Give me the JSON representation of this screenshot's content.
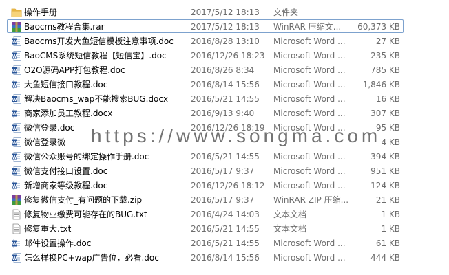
{
  "files": [
    {
      "name": "操作手册",
      "date": "2017/5/12 18:13",
      "type": "文件夹",
      "size": "",
      "icon": "folder-icon",
      "selected": false
    },
    {
      "name": "Baocms教程合集.rar",
      "date": "2017/5/12 18:13",
      "type": "WinRAR 压缩文...",
      "size": "60,373 KB",
      "icon": "winrar-icon",
      "selected": true
    },
    {
      "name": "Baocms开发大鱼短信模板注意事项.doc",
      "date": "2016/8/28 13:10",
      "type": "Microsoft Word ...",
      "size": "27 KB",
      "icon": "word-doc-icon",
      "selected": false
    },
    {
      "name": "BaoCMS系统短信教程【短信宝】.doc",
      "date": "2016/12/26 18:23",
      "type": "Microsoft Word ...",
      "size": "235 KB",
      "icon": "word-doc-icon",
      "selected": false
    },
    {
      "name": "O2O源码APP打包教程.doc",
      "date": "2016/8/26 8:34",
      "type": "Microsoft Word ...",
      "size": "785 KB",
      "icon": "word-doc-icon",
      "selected": false
    },
    {
      "name": "大鱼短信接口教程.doc",
      "date": "2016/8/14 15:56",
      "type": "Microsoft Word ...",
      "size": "1,846 KB",
      "icon": "word-doc-icon",
      "selected": false
    },
    {
      "name": "解决Baocms_wap不能搜索BUG.docx",
      "date": "2016/5/21 14:55",
      "type": "Microsoft Word ...",
      "size": "16 KB",
      "icon": "word-docx-icon",
      "selected": false
    },
    {
      "name": "商家添加员工教程.docx",
      "date": "2016/9/13 9:40",
      "type": "Microsoft Word ...",
      "size": "307 KB",
      "icon": "word-docx-icon",
      "selected": false
    },
    {
      "name": "微信登录.doc",
      "date": "2016/12/26 18:19",
      "type": "Microsoft Word ...",
      "size": "95 KB",
      "icon": "word-doc-icon",
      "selected": false
    },
    {
      "name": "微信登录微",
      "date": "",
      "type": "",
      "size": "4 KB",
      "icon": "word-doc-icon",
      "selected": false
    },
    {
      "name": "微信公众账号的绑定操作手册.doc",
      "date": "2016/5/21 14:55",
      "type": "Microsoft Word ...",
      "size": "394 KB",
      "icon": "word-doc-icon",
      "selected": false
    },
    {
      "name": "微信支付接口设置.doc",
      "date": "2016/5/17 9:37",
      "type": "Microsoft Word ...",
      "size": "951 KB",
      "icon": "word-doc-icon",
      "selected": false
    },
    {
      "name": "新增商家等级教程.doc",
      "date": "2016/12/26 18:12",
      "type": "Microsoft Word ...",
      "size": "124 KB",
      "icon": "word-doc-icon",
      "selected": false
    },
    {
      "name": "修复微信支付_有问题的下载.zip",
      "date": "2016/5/17 9:37",
      "type": "WinRAR ZIP 压缩...",
      "size": "21 KB",
      "icon": "winrar-zip-icon",
      "selected": false
    },
    {
      "name": "修复物业缴费可能存在的BUG.txt",
      "date": "2016/4/24 14:03",
      "type": "文本文档",
      "size": "1 KB",
      "icon": "text-file-icon",
      "selected": false
    },
    {
      "name": "修复重大.txt",
      "date": "2016/5/21 14:55",
      "type": "文本文档",
      "size": "1 KB",
      "icon": "text-file-icon",
      "selected": false
    },
    {
      "name": "邮件设置操作.doc",
      "date": "2016/5/21 14:55",
      "type": "Microsoft Word ...",
      "size": "61 KB",
      "icon": "word-doc-icon",
      "selected": false
    },
    {
      "name": "怎么样换PC+wap广告位，必看.doc",
      "date": "2016/8/14 15:56",
      "type": "Microsoft Word ...",
      "size": "444 KB",
      "icon": "word-doc-icon",
      "selected": false
    }
  ],
  "watermark": "https://www.songma.com",
  "colors": {
    "selection_border": "#7da2ce",
    "secondary_text": "#6d6d6d",
    "word_blue": "#2b579a",
    "folder_yellow": "#f2c14e"
  }
}
